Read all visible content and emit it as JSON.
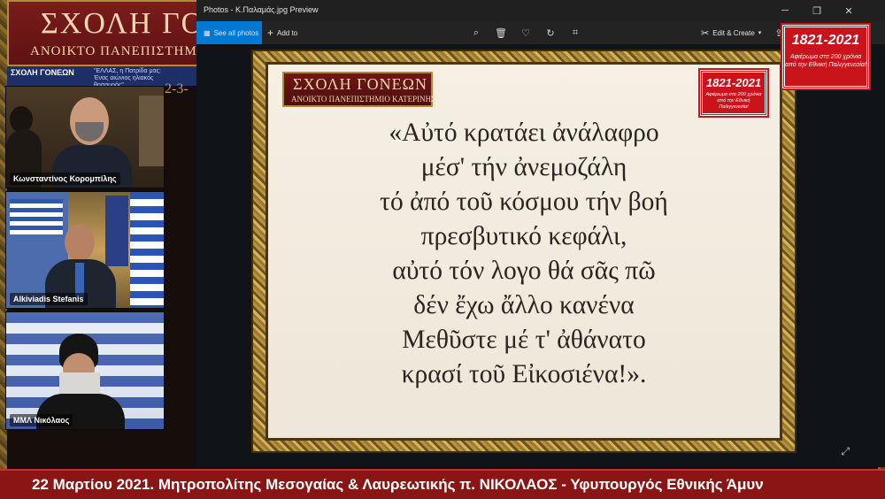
{
  "background": {
    "school_title": "ΣΧΟΛΗ ΓΟΝΕΩΝ",
    "school_subtitle": "ΑΝΟΙΚΤΟ ΠΑΝΕΠΙΣΤΗΜΙΟ ΚΑΤΕΡΙΝΗΣ",
    "strip_left": "ΣΧΟΛΗ ΓΟΝΕΩΝ",
    "strip_right": "\"ΕΛΛΑΣ, η Πατρίδα μας: Ένας αιώνιος ηλιακός θησαυρός\"",
    "date_fragment": "2-3-"
  },
  "participants": [
    {
      "name": "Κωνσταντίνος Κορομπίλης"
    },
    {
      "name": "Alkiviadis Stefanis"
    },
    {
      "name": "ΜΜΛ Νικόλαος"
    }
  ],
  "photos_window": {
    "title": "Photos - Κ.Παλαμάς.jpg Preview",
    "toolbar": {
      "see_all": "See all photos",
      "add_to": "Add to",
      "edit_create": "Edit & Create"
    },
    "icons": [
      "zoom-icon",
      "delete-icon",
      "heart-icon",
      "rotate-icon",
      "crop-icon",
      "edit-icon",
      "share-icon",
      "more-icon",
      "expand-icon"
    ]
  },
  "image": {
    "banner_title": "ΣΧΟΛΗ ΓΟΝΕΩΝ",
    "banner_subtitle": "ΑΝΟΙΚΤΟ ΠΑΝΕΠΙΣΤΗΜΙΟ ΚΑΤΕΡΙΝΗΣ",
    "stamp_year": "1821-2021",
    "stamp_text": "Αφιέρωμα στα 200 χρόνια από την Εθνική Παλιγγενεσία!",
    "poem_lines": [
      "«Αὐτό κρατάει ἀνάλαφρο",
      "μέσ' τήν ἀνεμοζάλη",
      "τό ἀπό τοῦ κόσμου τήν βοή",
      "πρεσβυτικό κεφάλι,",
      "αὐτό τόν λογο θά σᾶς πῶ",
      "δέν ἔχω ἄλλο κανένα",
      "Μεθῦστε μέ τ' ἀθάνατο",
      "κρασί τοῦ Εἰκοσιένα!»."
    ]
  },
  "overlay_stamp": {
    "year": "1821-2021",
    "text": "Αφιέρωμα στα 200 χρόνια από την Εθνική Παλιγγενεσία!"
  },
  "ticker": {
    "text": "22 Μαρτίου 2021. Μητροπολίτης Μεσογαίας & Λαυρεωτικής π. ΝΙΚΟΛΑΟΣ - Υφυπουργός Εθνικής Άμυν"
  },
  "colors": {
    "ticker_bg": "#8a1515",
    "stamp_red": "#c8141a",
    "accent_blue": "#0078d4"
  }
}
